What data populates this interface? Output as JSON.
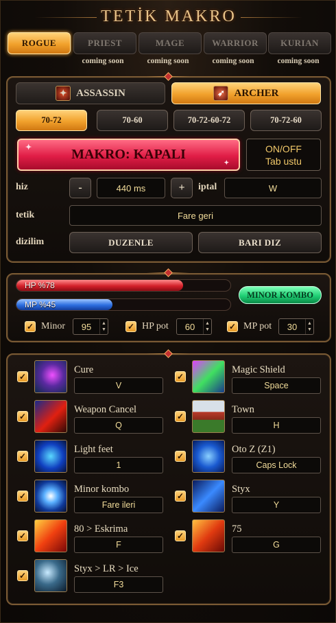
{
  "title": "TETİK MAKRO",
  "class_tabs": [
    {
      "label": "ROGUE",
      "active": true,
      "note": ""
    },
    {
      "label": "PRIEST",
      "active": false,
      "note": "coming soon"
    },
    {
      "label": "MAGE",
      "active": false,
      "note": "coming soon"
    },
    {
      "label": "WARRIOR",
      "active": false,
      "note": "coming soon"
    },
    {
      "label": "KURIAN",
      "active": false,
      "note": "coming soon"
    }
  ],
  "specs": [
    {
      "label": "ASSASSIN",
      "active": false,
      "icon": "assassin-icon"
    },
    {
      "label": "ARCHER",
      "active": true,
      "icon": "archer-icon"
    }
  ],
  "levels": [
    {
      "label": "70-72",
      "active": true
    },
    {
      "label": "70-60",
      "active": false
    },
    {
      "label": "70-72-60-72",
      "active": false
    },
    {
      "label": "70-72-60",
      "active": false
    }
  ],
  "makro": {
    "label": "MAKRO: KAPALI",
    "hint_line1": "ON/OFF",
    "hint_line2": "Tab ustu"
  },
  "settings": {
    "hiz_label": "hiz",
    "minus": "-",
    "hiz_value": "440 ms",
    "plus": "+",
    "iptal_label": "iptal",
    "iptal_key": "W",
    "tetik_label": "tetik",
    "tetik_value": "Fare geri",
    "dizilim_label": "dizilim",
    "duzenle": "DUZENLE",
    "bari_diz": "BARI DIZ"
  },
  "bars": {
    "hp_label": "HP  %78",
    "hp_percent": 78,
    "mp_label": "MP  %45",
    "mp_percent": 45,
    "minor_kombo": "MINOR KOMBO"
  },
  "potions": [
    {
      "label": "Minor",
      "value": "95",
      "checked": true
    },
    {
      "label": "HP pot",
      "value": "60",
      "checked": true
    },
    {
      "label": "MP pot",
      "value": "30",
      "checked": true
    }
  ],
  "skills": [
    {
      "name": "Cure",
      "key": "V",
      "checked": true,
      "icon": "cure-icon"
    },
    {
      "name": "Magic Shield",
      "key": "Space",
      "checked": true,
      "icon": "magic-shield-icon"
    },
    {
      "name": "Weapon Cancel",
      "key": "Q",
      "checked": true,
      "icon": "weapon-cancel-icon"
    },
    {
      "name": "Town",
      "key": "H",
      "checked": true,
      "icon": "town-icon"
    },
    {
      "name": "Light feet",
      "key": "1",
      "checked": true,
      "icon": "light-feet-icon"
    },
    {
      "name": "Oto Z (Z1)",
      "key": "Caps Lock",
      "checked": true,
      "icon": "oto-z-icon"
    },
    {
      "name": "Minor kombo",
      "key": "Fare ileri",
      "checked": true,
      "icon": "minor-kombo-icon"
    },
    {
      "name": "Styx",
      "key": "Y",
      "checked": true,
      "icon": "styx-icon"
    },
    {
      "name": "80 > Eskrima",
      "key": "F",
      "checked": true,
      "icon": "eskrima-icon"
    },
    {
      "name": "75",
      "key": "G",
      "checked": true,
      "icon": "skill-75-icon"
    },
    {
      "name": "Styx > LR > Ice",
      "key": "F3",
      "checked": true,
      "icon": "styx-lr-ice-icon"
    }
  ]
}
